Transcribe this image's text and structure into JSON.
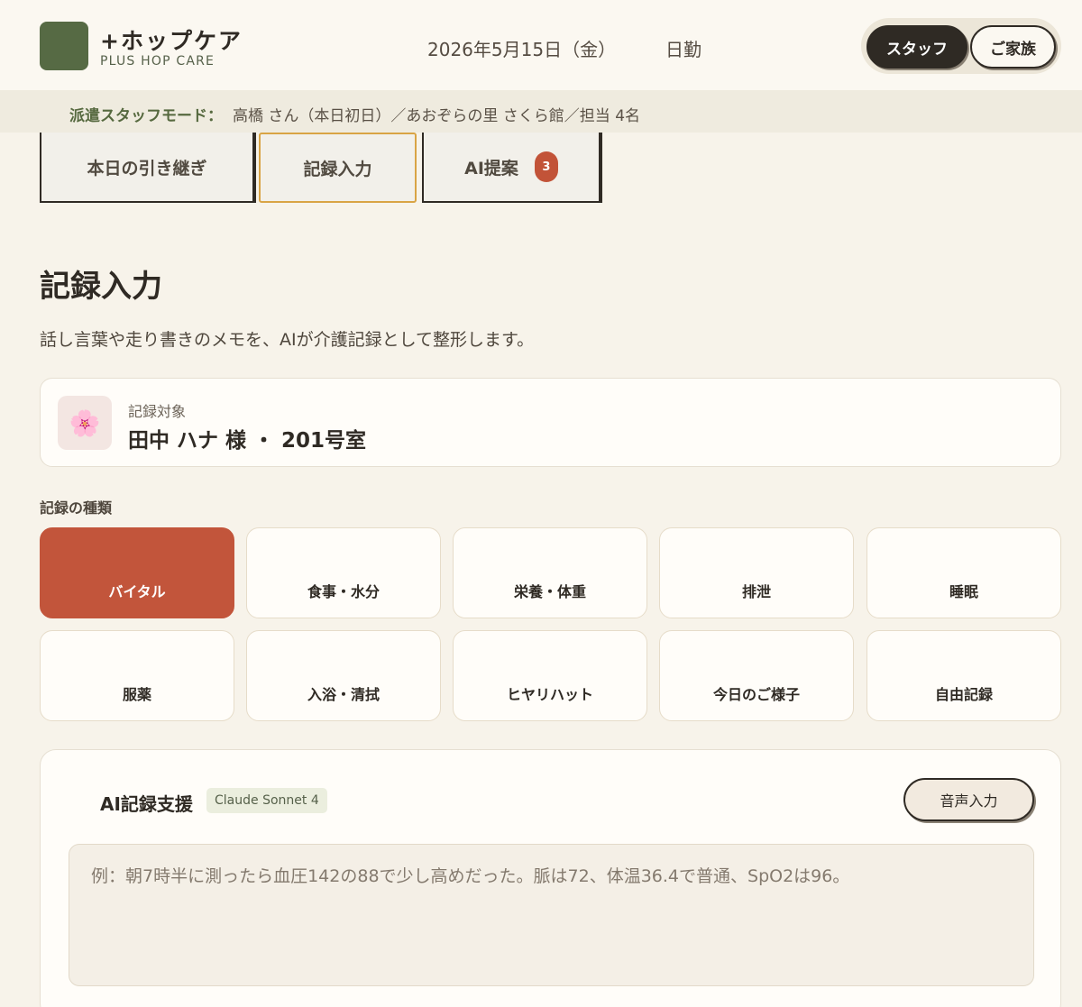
{
  "header": {
    "brand_name": "+ホップケア",
    "brand_sub": "PLUS HOP CARE",
    "date": "2026年5月15日（金）",
    "shift": "日勤",
    "roles": [
      "スタッフ",
      "ご家族"
    ]
  },
  "mode_bar": {
    "label": "派遣スタッフモード：",
    "text": "高橋 さん（本日初日）／あおぞらの里 さくら館／担当 4名"
  },
  "tabs": [
    {
      "label": "本日の引き継ぎ"
    },
    {
      "label": "記録入力"
    },
    {
      "label": "AI提案",
      "badge": "3"
    }
  ],
  "page": {
    "title": "記録入力",
    "description": "話し言葉や走り書きのメモを、AIが介護記録として整形します。"
  },
  "target": {
    "avatar_emoji": "🌸",
    "label": "記録対象",
    "name": "田中 ハナ 様 ・ 201号室"
  },
  "record_types": {
    "label": "記録の種類",
    "selected": "バイタル",
    "items": [
      "バイタル",
      "食事・水分",
      "栄養・体重",
      "排泄",
      "睡眠",
      "服薬",
      "入浴・清拭",
      "ヒヤリハット",
      "今日のご様子",
      "自由記録"
    ]
  },
  "ai_support": {
    "title": "AI記録支援",
    "model": "Claude Sonnet 4",
    "voice_button": "音声入力",
    "input_value": "",
    "input_placeholder": "例：朝7時半に測ったら血圧142の88で少し高めだった。脈は72、体温36.4で普通、SpO2は96。"
  },
  "colors": {
    "accent": "#566a44",
    "selected": "#c2553b",
    "badge": "#c25338",
    "active_tab_border": "#d9a445",
    "background": "#f7f3ea"
  }
}
